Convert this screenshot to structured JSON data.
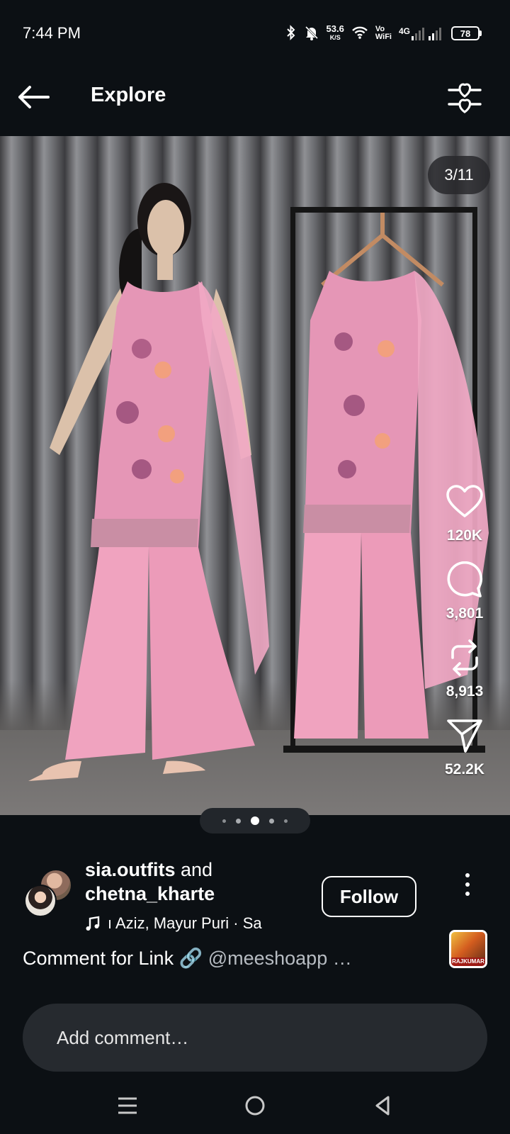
{
  "status_bar": {
    "time": "7:44 PM",
    "net_speed_value": "53.6",
    "net_speed_unit": "K/S",
    "vowifi_top": "Vo",
    "vowifi_bottom": "WiFi",
    "signal_label": "4G",
    "battery": "78",
    "icons": [
      "bluetooth-icon",
      "bell-off-icon",
      "wifi-icon",
      "signal-icon"
    ]
  },
  "header": {
    "title": "Explore",
    "back_icon": "back-arrow-icon",
    "filter_icon": "filter-hearts-icon"
  },
  "media": {
    "counter": "3/11",
    "description": "",
    "carousel_dots": 5,
    "active_dot": 2
  },
  "actions": {
    "like_count": "120K",
    "comment_count": "3,801",
    "repost_count": "8,913",
    "share_count": "52.2K"
  },
  "post": {
    "author_1": "sia.outfits",
    "connector": " and",
    "author_2": "chetna_kharte",
    "audio_text": "ı Aziz, Mayur Puri · Sa",
    "follow_label": "Follow",
    "caption_text": "Comment for Link 🔗 ",
    "caption_mention": "@meeshoapp …",
    "music_thumb_label": "RAJKUMAR"
  },
  "comment": {
    "placeholder": "Add comment…"
  },
  "colors": {
    "background": "#0c1014",
    "comment_box": "#262a2f",
    "text": "#ffffff",
    "muted": "#b7bcc2"
  }
}
